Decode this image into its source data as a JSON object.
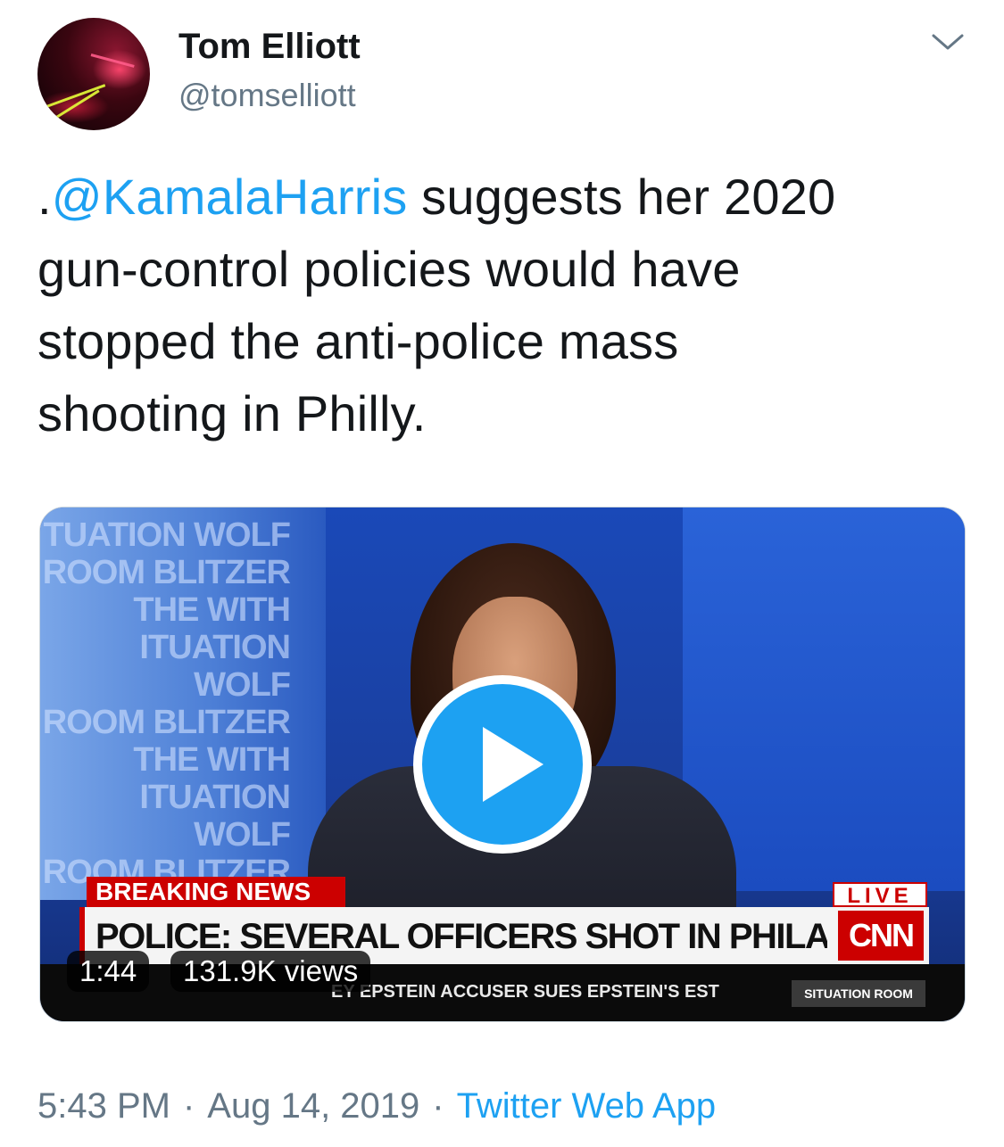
{
  "author": {
    "name": "Tom Elliott",
    "handle": "@tomselliott",
    "avatar_icon": "profile-photo-avatar"
  },
  "tweet": {
    "lines": [
      {
        "prefix": ".",
        "mention": "@KamalaHarris",
        "rest": " suggests her 2020"
      },
      {
        "text": "gun-control policies would have"
      },
      {
        "text": "stopped the anti-police mass"
      },
      {
        "text": "shooting in Philly."
      }
    ]
  },
  "media": {
    "duration": "1:44",
    "views": "131.9K views",
    "play_icon": "play-icon",
    "frame": {
      "wall_lines": [
        "TUATION WOLF",
        "ROOM BLITZER",
        "THE WITH",
        "ITUATION WOLF",
        "ROOM BLITZER",
        "THE WITH",
        "ITUATION WOLF",
        "ROOM BLITZER",
        "THE WITH"
      ],
      "breaking_label": "BREAKING NEWS",
      "live_label": "LIVE",
      "headline": "POLICE: SEVERAL OFFICERS SHOT IN PHILADELPHIA",
      "network_logo": "CNN",
      "ticker": "EY EPSTEIN ACCUSER SUES EPSTEIN'S EST",
      "ticker_brand": "SITUATION ROOM"
    }
  },
  "meta": {
    "time": "5:43 PM",
    "separator": "·",
    "date": "Aug 14, 2019",
    "source": "Twitter Web App"
  },
  "colors": {
    "link": "#1da1f2",
    "secondary": "#657786",
    "text": "#14171a",
    "cnn_red": "#cc0000"
  },
  "icons": {
    "menu_caret": "chevron-down-icon"
  }
}
